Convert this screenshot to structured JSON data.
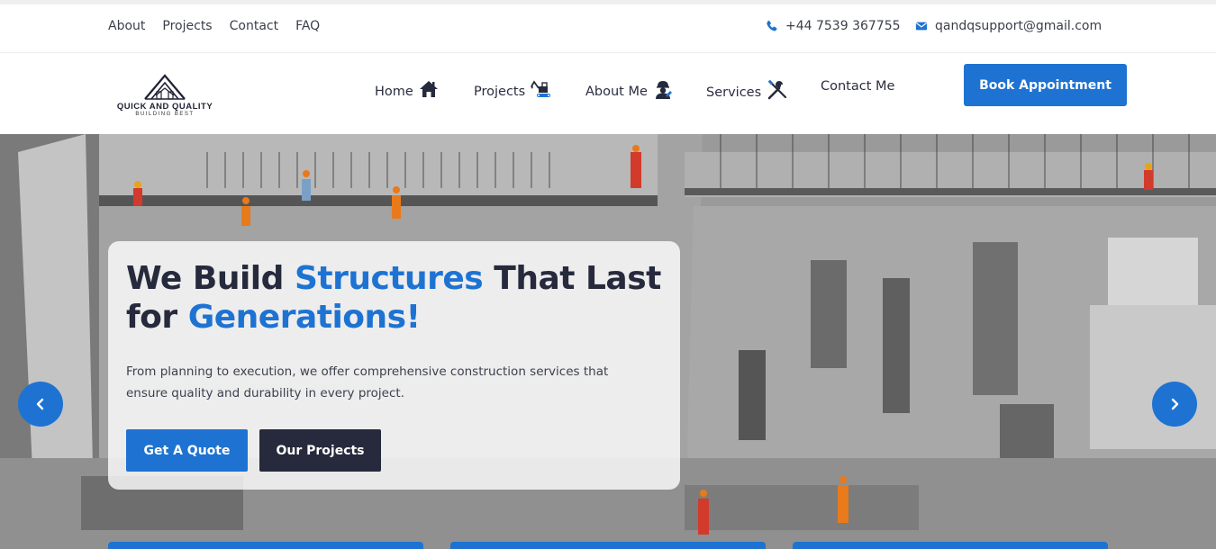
{
  "topbar": {
    "links": [
      "About",
      "Projects",
      "Contact",
      "FAQ"
    ],
    "phone": "+44 7539 367755",
    "email": "qandqsupport@gmail.com"
  },
  "logo": {
    "name": "QUICK AND QUALITY",
    "tagline": "BUILDING BEST"
  },
  "nav": {
    "home": "Home",
    "projects": "Projects",
    "about": "About Me",
    "services": "Services",
    "contact": "Contact Me",
    "cta": "Book Appointment"
  },
  "hero": {
    "title_part1": "We Build ",
    "title_accent1": "Structures",
    "title_part2": " That Last for ",
    "title_accent2": "Generations!",
    "description": "From planning to execution, we offer comprehensive construction services that ensure quality and durability in every project.",
    "primary_button": "Get A Quote",
    "secondary_button": "Our Projects"
  },
  "icons": {
    "phone": "phone-icon",
    "email": "envelope-icon",
    "home": "house-icon",
    "projects": "excavator-icon",
    "about": "worker-icon",
    "services": "tools-icon",
    "prev": "chevron-left-icon",
    "next": "chevron-right-icon"
  },
  "colors": {
    "accent": "#1e73d2",
    "dark": "#262a3c"
  }
}
